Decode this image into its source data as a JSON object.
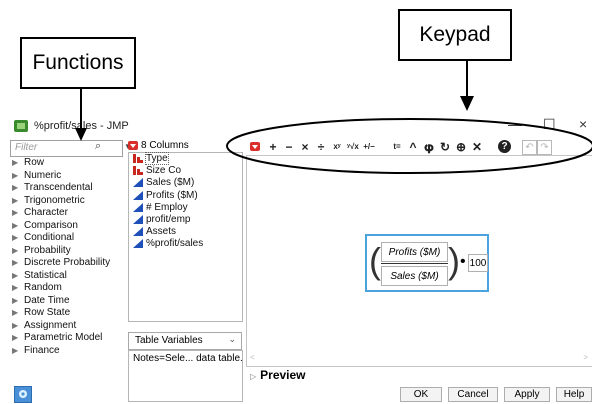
{
  "annotations": {
    "functions_label": "Functions",
    "keypad_label": "Keypad"
  },
  "window": {
    "title": "%profit/sales - JMP",
    "minimize": "—",
    "maximize": "☐",
    "close": "×"
  },
  "functions_panel": {
    "filter_placeholder": "Filter",
    "items": [
      "Row",
      "Numeric",
      "Transcendental",
      "Trigonometric",
      "Character",
      "Comparison",
      "Conditional",
      "Probability",
      "Discrete Probability",
      "Statistical",
      "Random",
      "Date Time",
      "Row State",
      "Assignment",
      "Parametric Model",
      "Finance"
    ]
  },
  "columns_panel": {
    "header": "8 Columns",
    "items": [
      {
        "label": "Type",
        "kind": "nominal"
      },
      {
        "label": "Size Co",
        "kind": "nominal"
      },
      {
        "label": "Sales ($M)",
        "kind": "continuous"
      },
      {
        "label": "Profits ($M)",
        "kind": "continuous"
      },
      {
        "label": "# Employ",
        "kind": "continuous"
      },
      {
        "label": "profit/emp",
        "kind": "continuous"
      },
      {
        "label": "Assets",
        "kind": "continuous"
      },
      {
        "label": "%profit/sales",
        "kind": "continuous"
      }
    ],
    "table_variables_label": "Table Variables",
    "table_variables_value": "Notes=Sele... data table."
  },
  "keypad": {
    "buttons": [
      "+",
      "−",
      "×",
      "÷",
      "xʸ",
      "ʸ√x",
      "+/−",
      "t=",
      "^",
      "𝛗",
      "↻",
      "⊕",
      "✕"
    ],
    "help": "?",
    "undo": "↶",
    "redo": "↷"
  },
  "formula": {
    "numerator": "Profits ($M)",
    "denominator": "Sales ($M)",
    "operator": "•",
    "multiplier": "100"
  },
  "preview_label": "Preview",
  "buttons": {
    "ok": "OK",
    "cancel": "Cancel",
    "apply": "Apply",
    "help": "Help"
  }
}
